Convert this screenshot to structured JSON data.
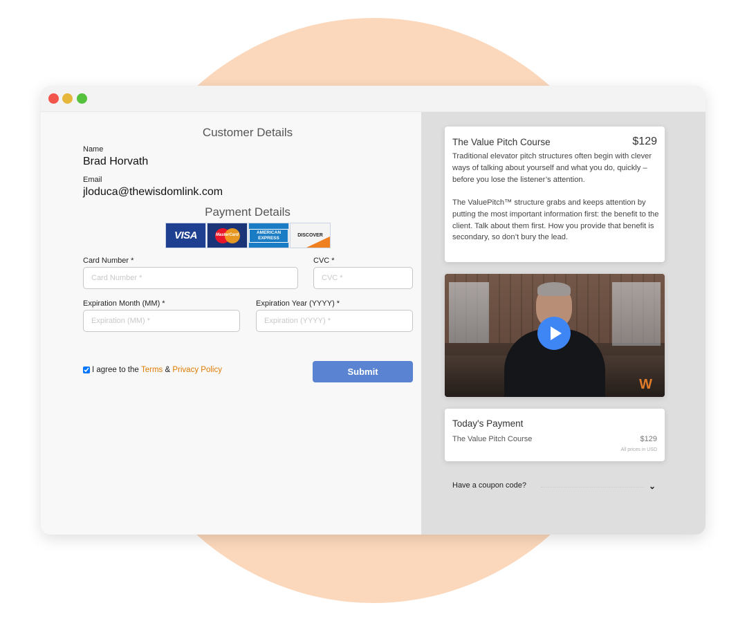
{
  "customer": {
    "section_title": "Customer Details",
    "name_label": "Name",
    "name_value": "Brad Horvath",
    "email_label": "Email",
    "email_value": "jloduca@thewisdomlink.com"
  },
  "payment": {
    "section_title": "Payment Details",
    "card_brands": [
      "VISA",
      "MasterCard",
      "AMERICAN EXPRESS",
      "DISCOVER"
    ],
    "card_number_label": "Card Number *",
    "card_number_placeholder": "Card Number *",
    "cvc_label": "CVC *",
    "cvc_placeholder": "CVC *",
    "exp_month_label": "Expiration Month (MM) *",
    "exp_month_placeholder": "Expiration (MM) *",
    "exp_year_label": "Expiration Year (YYYY) *",
    "exp_year_placeholder": "Expiration (YYYY) *",
    "agree_prefix": "I agree to the",
    "terms_label": "Terms",
    "agree_amp": "&",
    "privacy_label": "Privacy Policy",
    "agree_checked": true,
    "submit_label": "Submit"
  },
  "course": {
    "title": "The Value Pitch Course",
    "price": "$129",
    "paragraph1": "Traditional elevator pitch structures often begin with clever ways of talking about yourself and what you do, quickly – before you lose the listener’s attention.",
    "paragraph2": "The ValuePitch™ structure grabs and keeps attention by putting the most important information first: the benefit to the client. Talk about them first. How you provide that benefit is secondary, so don’t bury the lead."
  },
  "video": {
    "watermark": "W"
  },
  "todays_payment": {
    "title": "Today's Payment",
    "item": "The Value Pitch Course",
    "price": "$129",
    "note": "All prices in USD"
  },
  "coupon": {
    "label": "Have a coupon code?"
  },
  "colors": {
    "accent_link": "#e07b00",
    "submit_bg": "#5a84d1",
    "play_button": "#3f86f5",
    "background_blob": "#fbd7bb"
  },
  "icons": [
    "close-dot",
    "minimize-dot",
    "maximize-dot",
    "play-icon",
    "chevron-down-icon"
  ]
}
